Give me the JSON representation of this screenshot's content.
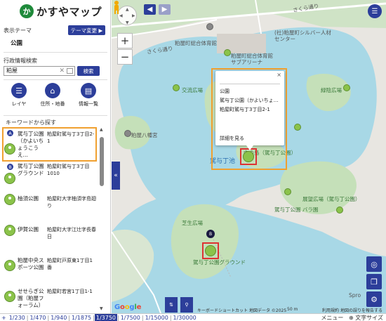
{
  "app": {
    "logo_mark": "か",
    "title": "かすやマップ"
  },
  "sidebar": {
    "theme_label": "表示テーマ",
    "theme_change_button": "テーマ変更 ▶",
    "theme_value": "公園",
    "admin_search_label": "行政情報検索",
    "search_value": "粕屋",
    "search_clear": "✕",
    "search_button": "検索",
    "tools": [
      {
        "label": "レイヤ",
        "icon": "list-icon"
      },
      {
        "label": "住所・地番",
        "icon": "home-icon"
      },
      {
        "label": "情報一覧",
        "icon": "table-icon"
      }
    ],
    "keyword_label": "キーワードから探す",
    "results": [
      {
        "letter": "A",
        "name": "駕与丁公園（かよいちょうこうえ…",
        "address": "粕屋町駕与丁3丁目2-1"
      },
      {
        "letter": "B",
        "name": "駕与丁公園グラウンド",
        "address": "粕屋町駕与丁3丁目1010"
      },
      {
        "letter": "",
        "name": "柚須公園",
        "address": "粕屋町大字柚須字島廻り"
      },
      {
        "letter": "",
        "name": "伊賀公園",
        "address": "粕屋町大字江辻字長春日"
      },
      {
        "letter": "",
        "name": "粕屋中央スポーツ公園",
        "address": "粕屋町戸原東1丁目1番"
      },
      {
        "letter": "",
        "name": "せせらぎ公園（粕屋フォーラム）",
        "address": "粕屋町若宮1丁目1-1"
      }
    ],
    "collapse_icon": "«"
  },
  "map": {
    "labels": {
      "sakura_dori_1": "さくら通り",
      "sakura_dori_2": "さくら通り",
      "shirubaa": "(社)粕屋町シルバー人材センター",
      "sogo_taiikukan": "粕屋町総合体育館",
      "sogo_plaza": "粕屋町総合体育館サブアリーナ",
      "koryu_hiroba": "交流広場",
      "ryokuin_hiroba": "緑陰広場",
      "kasuya_hachimangu": "粕屋八幡宮",
      "nakanoshima": "中の島（駕与丁公園）",
      "kayoicho_ike": "駕与丁池",
      "tenbou_hiroba": "展望広場（駕与丁公園）",
      "bara_en": "駕与丁公園 バラ園",
      "shibafu": "芝生広場",
      "ground": "駕与丁公園グラウンド",
      "rose": "Spro"
    },
    "popup": {
      "category": "公園",
      "name": "駕与丁公園（かよいちょ…",
      "address": "粕屋町駕与丁3丁目2-1",
      "detail_link": "詳細を見る",
      "close": "×"
    },
    "marker_letter": "B",
    "attribution": {
      "shortcuts": "キーボードショートカット",
      "map_data": "地図データ ©2025",
      "scale": "50 m",
      "terms": "利用規約",
      "report": "地図の誤りを報告する"
    },
    "google_logo": "Google"
  },
  "scales": [
    "1/230",
    "1/470",
    "1/940",
    "1/1875",
    "1/3750",
    "1/7500",
    "1/15000",
    "1/30000"
  ],
  "active_scale": "1/3750",
  "bottom_right": {
    "menu": "メニュー",
    "font_size": "⊕ 文字サイズ"
  }
}
